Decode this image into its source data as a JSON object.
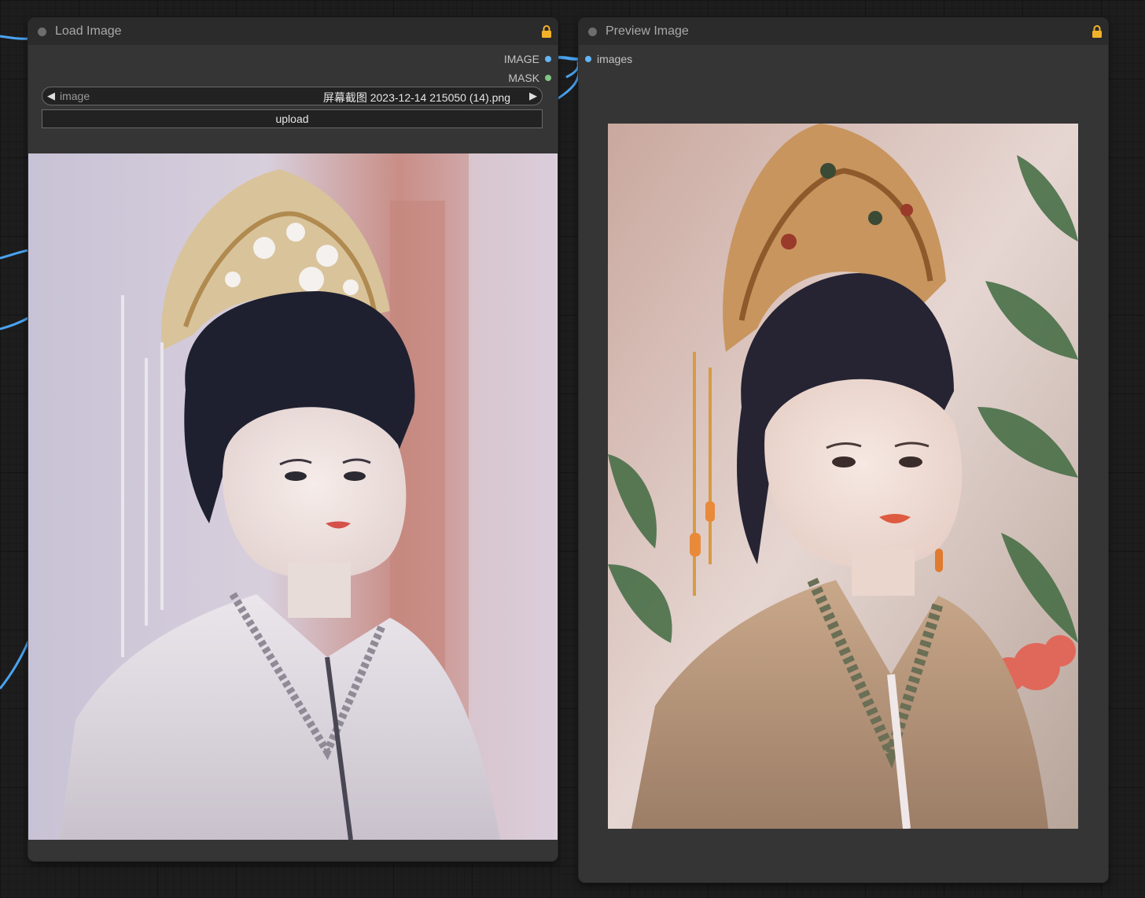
{
  "load_image_node": {
    "title": "Load Image",
    "outputs": [
      {
        "label": "IMAGE",
        "color": "#64b5f6"
      },
      {
        "label": "MASK",
        "color": "#81c784"
      }
    ],
    "image_widget": {
      "label": "image",
      "value": "屏幕截图 2023-12-14 215050 (14).png"
    },
    "upload_label": "upload"
  },
  "preview_image_node": {
    "title": "Preview Image",
    "inputs": [
      {
        "label": "images",
        "color": "#64b5f6"
      }
    ]
  },
  "colors": {
    "wire": "#4aa3f0",
    "lock": "#f2b32b",
    "node_bg": "#353535",
    "title_bg": "#2b2b2b"
  },
  "icons": {
    "lock": "lock-icon",
    "arrow_left": "arrow-left-icon",
    "arrow_right": "arrow-right-icon"
  }
}
